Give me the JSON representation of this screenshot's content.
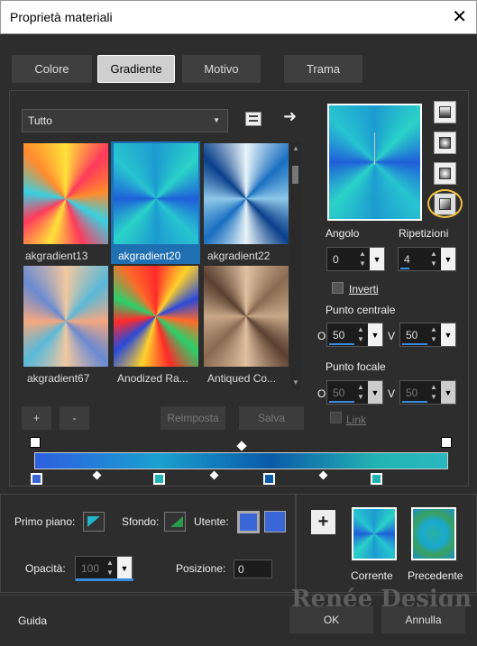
{
  "window": {
    "title": "Proprietà materiali",
    "close_glyph": "✕"
  },
  "tabs": [
    {
      "label": "Colore",
      "active": false
    },
    {
      "label": "Gradiente",
      "active": true
    },
    {
      "label": "Motivo",
      "active": false
    },
    {
      "label": "Trama",
      "active": false
    }
  ],
  "category": {
    "selected": "Tutto"
  },
  "gradients": [
    {
      "name": "akgradient13",
      "selected": false
    },
    {
      "name": "akgradient20",
      "selected": true
    },
    {
      "name": "akgradient22",
      "selected": false
    },
    {
      "name": "akgradient67",
      "selected": false
    },
    {
      "name": "Anodized Ra...",
      "selected": false
    },
    {
      "name": "Antiqued Co...",
      "selected": false
    }
  ],
  "list_buttons": {
    "add": "+",
    "remove": "-",
    "reset": "Reimposta",
    "save": "Salva"
  },
  "angle": {
    "label": "Angolo",
    "value": "0"
  },
  "repeats": {
    "label": "Ripetizioni",
    "value": "4"
  },
  "invert": {
    "label": "Inverti",
    "checked": false
  },
  "center_point": {
    "label": "Punto centrale",
    "o_label": "O",
    "o_value": "50",
    "v_label": "V",
    "v_value": "50"
  },
  "focal_point": {
    "label": "Punto focale",
    "o_label": "O",
    "o_value": "50",
    "v_label": "V",
    "v_value": "50"
  },
  "link": {
    "label": "Link",
    "checked": false
  },
  "bottom": {
    "foreground_label": "Primo piano:",
    "background_label": "Sfondo:",
    "user_label": "Utente:",
    "opacity_label": "Opacità:",
    "opacity_value": "100",
    "position_label": "Posizione:",
    "position_value": "0",
    "current_label": "Corrente",
    "previous_label": "Precedente",
    "add_glyph": "+"
  },
  "footer": {
    "help": "Guida",
    "ok": "OK",
    "cancel": "Annulla",
    "watermark": "Renée Design"
  },
  "colors": {
    "accent_blue": "#3a66d8",
    "teal": "#22b4b4",
    "selection": "#1f6fb3",
    "highlight_circle": "#f0c040"
  }
}
